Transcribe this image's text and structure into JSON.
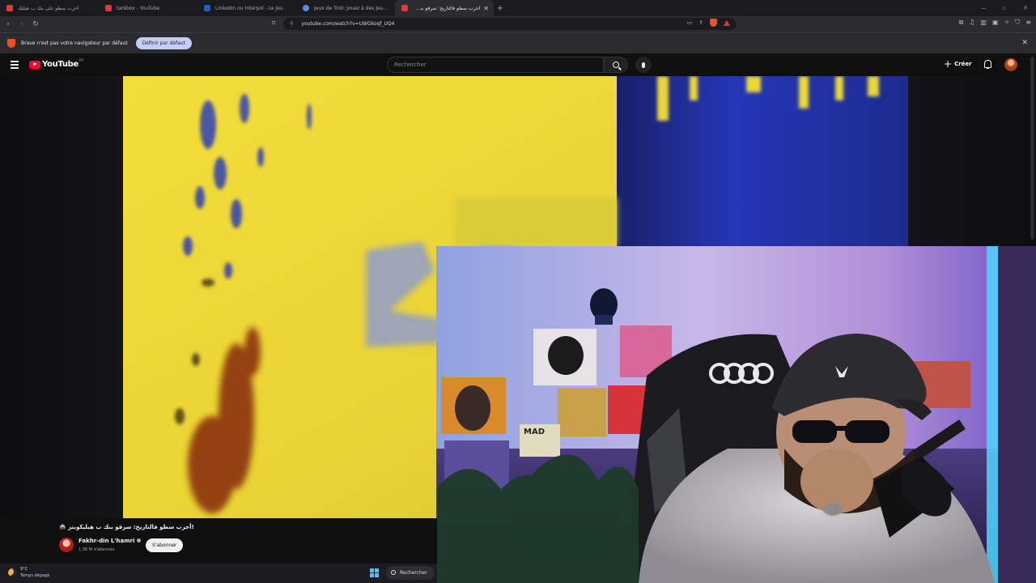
{
  "browser": {
    "tabs": [
      {
        "title": "أحرب سطو على بنك ب هيليك",
        "favicon_color": "#e53935",
        "active": false
      },
      {
        "title": "tarkbox - YouTube",
        "favicon_color": "#e53935",
        "active": false
      },
      {
        "title": "LinkedIn ou Interpol - Le Jeu",
        "favicon_color": "#1565c0",
        "active": false
      },
      {
        "title": "Jeux de Troll: Jouez à des Jeux de Tr",
        "favicon_color": "#5e8bd6",
        "active": false
      },
      {
        "title": "أحرب سطو فالتاريخ: سرقو بنك ب",
        "favicon_color": "#e53935",
        "active": true
      }
    ],
    "new_tab_icon": "plus-icon",
    "window_controls": [
      "minimize-icon",
      "maximize-icon",
      "close-icon"
    ],
    "url": "youtube.com/watch?v=UWGkoqf_UQ4",
    "info_bar": {
      "message": "Brave n'est pas votre navigateur par défaut",
      "button_label": "Définir par défaut"
    }
  },
  "youtube": {
    "logo_text": "YouTube",
    "country_code": "FR",
    "search_placeholder": "Rechercher",
    "create_label": "Créer",
    "colors": {
      "brand_red": "#ff0033",
      "background": "#0f0f0f"
    }
  },
  "video": {
    "title": "!أحرب سطو فالتاريخ: سرقو بنك ب هيليكوبتر 🚔",
    "channel_name": "Fakhr-din L'hamri",
    "subscribers": "1,36 M d'abonnés",
    "subscribe_label": "S'abonner"
  },
  "taskbar": {
    "temperature": "9°C",
    "weather": "Temps dégagé",
    "search_label": "Rechercher"
  }
}
